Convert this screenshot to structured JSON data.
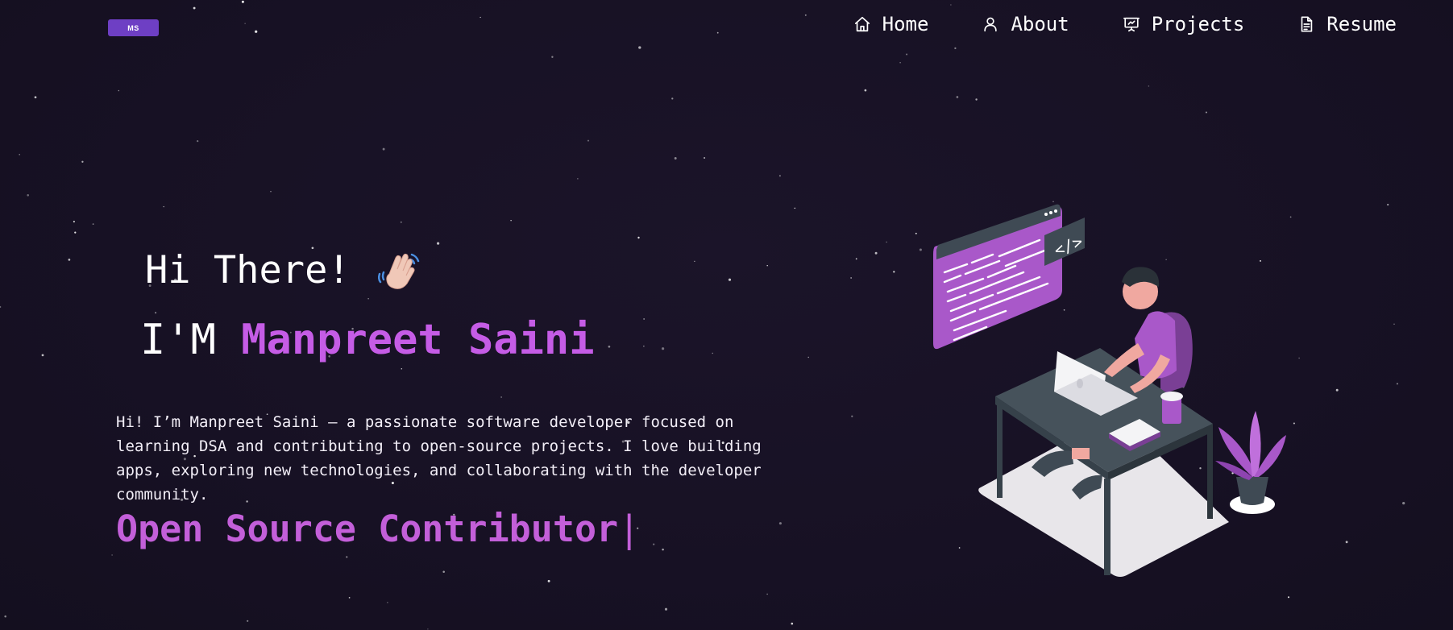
{
  "logo": {
    "text": "MS"
  },
  "nav": {
    "items": [
      {
        "label": "Home",
        "icon": "home-icon"
      },
      {
        "label": "About",
        "icon": "user-icon"
      },
      {
        "label": "Projects",
        "icon": "presentation-icon"
      },
      {
        "label": "Resume",
        "icon": "document-icon"
      }
    ]
  },
  "hero": {
    "greeting": "Hi There!",
    "wave_icon": "waving-hand-icon",
    "name_prefix": "I'M",
    "name": "Manpreet Saini",
    "bio": "Hi! I’m Manpreet Saini — a passionate software developer focused on learning DSA and contributing to open-source projects. I love building apps, exploring new technologies, and collaborating with the developer community.",
    "typed_text": "Open Source Contributor",
    "cursor": "|",
    "illustration": "developer-at-desk-illustration"
  },
  "colors": {
    "background": "#181226",
    "accent": "#c55ce6",
    "logo_bg": "#6e3fc4"
  }
}
